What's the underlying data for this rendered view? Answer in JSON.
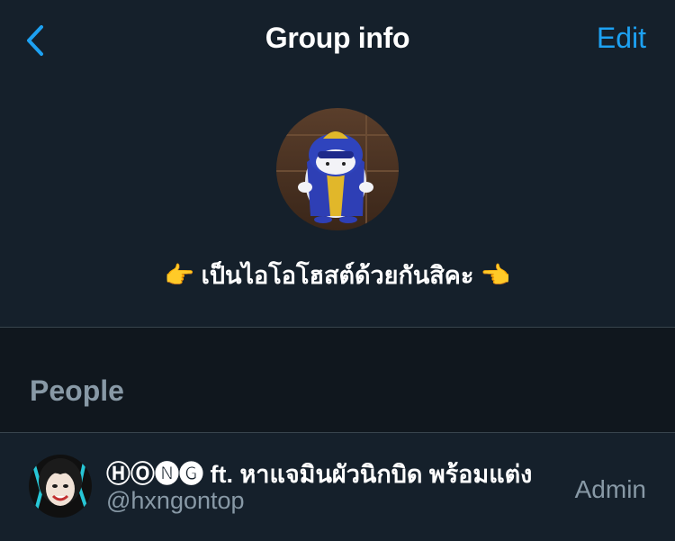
{
  "header": {
    "title": "Group info",
    "back_icon": "chevron-left-icon",
    "edit_label": "Edit",
    "accent_color": "#1da1f2"
  },
  "group": {
    "avatar_icon": "group-avatar-hamster-image",
    "name": "👉 เป็นไอโอโฮสต์ด้วยกันสิคะ 👈"
  },
  "people_section": {
    "title": "People",
    "members": [
      {
        "avatar_icon": "user-avatar-image",
        "name": "ⒽⓄ🅝🅖 ft. หาแจมินผัวนิกบิด พร้อมแต่ง",
        "handle": "@hxngontop",
        "role": "Admin"
      }
    ]
  }
}
